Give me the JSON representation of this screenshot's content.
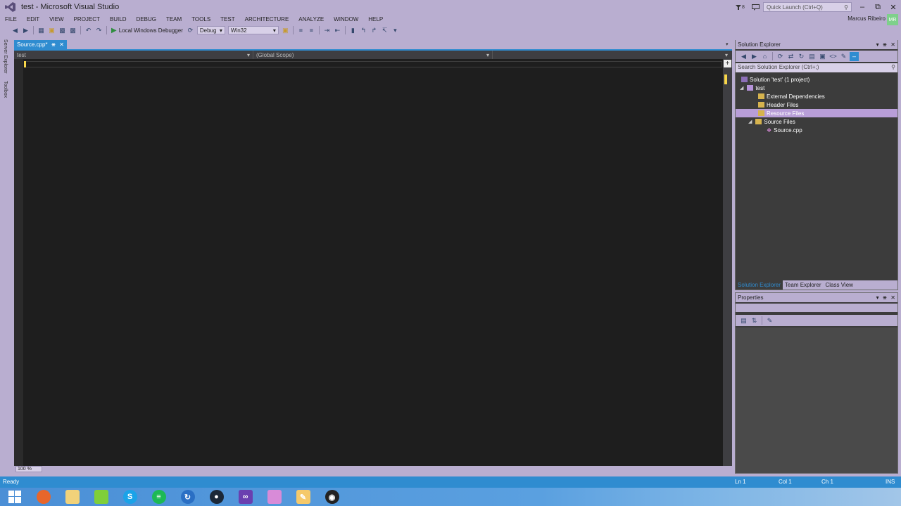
{
  "window": {
    "title": "test - Microsoft Visual Studio",
    "notification_count": "8",
    "quick_launch_placeholder": "Quick Launch (Ctrl+Q)",
    "user_name": "Marcus Ribeiro",
    "user_initials": "MR"
  },
  "menu": [
    "FILE",
    "EDIT",
    "VIEW",
    "PROJECT",
    "BUILD",
    "DEBUG",
    "TEAM",
    "TOOLS",
    "TEST",
    "ARCHITECTURE",
    "ANALYZE",
    "WINDOW",
    "HELP"
  ],
  "toolbar": {
    "debugger_label": "Local Windows Debugger",
    "configuration": "Debug",
    "platform": "Win32"
  },
  "left_strip": [
    "Server Explorer",
    "Toolbox"
  ],
  "editor": {
    "tab_label": "Source.cpp*",
    "project_combo": "test",
    "scope_combo": "(Global Scope)",
    "zoom": "100 %"
  },
  "solution_explorer": {
    "title": "Solution Explorer",
    "search_placeholder": "Search Solution Explorer (Ctrl+;)",
    "tree": {
      "solution": "Solution 'test' (1 project)",
      "project": "test",
      "external_dependencies": "External Dependencies",
      "header_files": "Header Files",
      "resource_files": "Resource Files",
      "source_files": "Source Files",
      "source_cpp": "Source.cpp"
    },
    "bottom_tabs": [
      "Solution Explorer",
      "Team Explorer",
      "Class View"
    ]
  },
  "properties": {
    "title": "Properties"
  },
  "status": {
    "state": "Ready",
    "line": "Ln 1",
    "col": "Col 1",
    "ch": "Ch 1",
    "mode": "INS"
  },
  "colors": {
    "accent": "#2f8cd0",
    "chrome": "#b9aed0",
    "editor_bg": "#1e1e1e",
    "selection": "#b89ed8"
  },
  "taskbar": {
    "icons": [
      "windows-start-icon",
      "firefox-icon",
      "file-explorer-icon",
      "green-app-icon",
      "skype-icon",
      "spotify-icon",
      "update-icon",
      "steam-icon",
      "visual-studio-icon",
      "paint-app-icon",
      "notepad-icon",
      "obs-icon"
    ]
  }
}
